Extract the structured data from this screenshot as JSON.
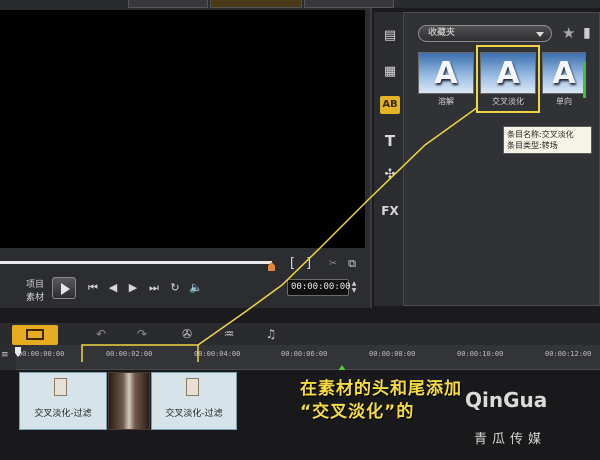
{
  "preview": {
    "mode_project": "项目",
    "mode_clip": "素材",
    "timecode": "00:00:00:00"
  },
  "library": {
    "category": "收藏夹",
    "thumbs": [
      {
        "glyph": "A",
        "label": "溶解"
      },
      {
        "glyph": "A",
        "label": "交叉淡化"
      },
      {
        "glyph": "A",
        "label": "单向"
      }
    ],
    "side_icons": [
      "film-strip",
      "video",
      "AB",
      "T",
      "effects",
      "FX"
    ],
    "tooltip": {
      "line1": "条目名称:交叉淡化",
      "line2": "条目类型:转场"
    }
  },
  "timeline": {
    "ruler_ticks": [
      "00:00:00:00",
      "00:00:02:00",
      "00:00:04:00",
      "00:00:06:00",
      "00:00:08:00",
      "00:00:10:00",
      "00:00:12:00"
    ],
    "clips": [
      {
        "label": "交叉淡化-过滤"
      },
      {
        "label": "交叉淡化-过滤"
      }
    ]
  },
  "annotation": {
    "line1": "在素材的头和尾添加",
    "line2": "“交叉淡化”的"
  },
  "watermark": {
    "brand": "QinGua",
    "sub": "青瓜传媒"
  },
  "colors": {
    "accent_yellow": "#f0d541",
    "storyboard_orange": "#e7ab1f",
    "caption_yellow": "#f5dd3f"
  }
}
